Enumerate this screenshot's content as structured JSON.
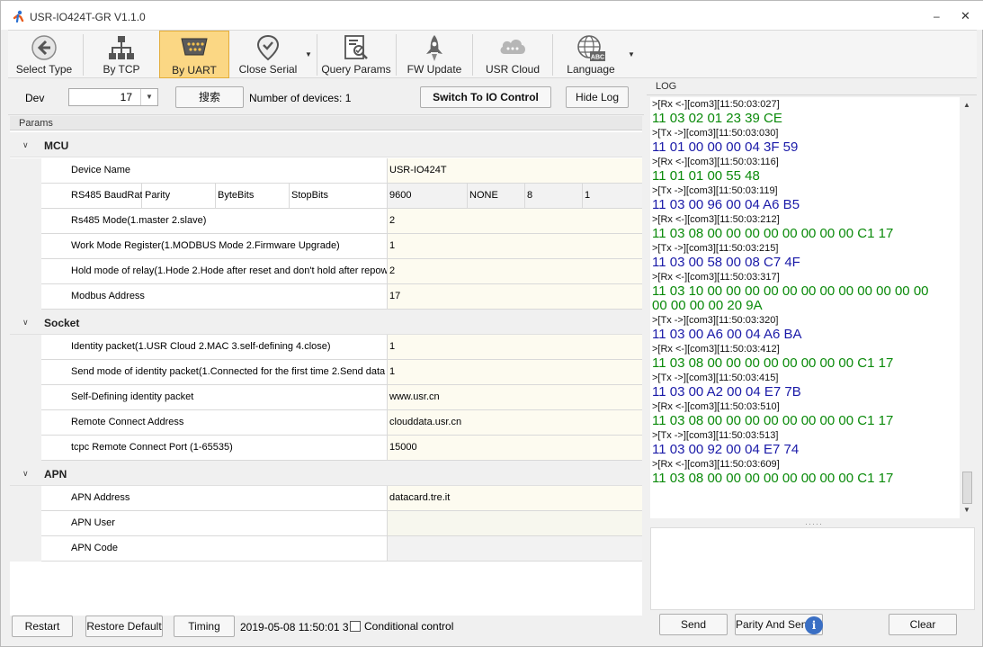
{
  "window": {
    "title": "USR-IO424T-GR V1.1.0"
  },
  "toolbar": {
    "select_type": "Select Type",
    "by_tcp": "By TCP",
    "by_uart": "By UART",
    "close_serial": "Close Serial",
    "query_params": "Query Params",
    "fw_update": "FW Update",
    "usr_cloud": "USR Cloud",
    "language": "Language",
    "language_badge": "ABC"
  },
  "device_bar": {
    "dev_label": "Dev",
    "dev_value": "17",
    "search_button": "搜索",
    "device_count": "Number of devices: 1",
    "switch_button": "Switch To IO Control",
    "hide_log_button": "Hide Log"
  },
  "params": {
    "header": "Params",
    "sections": {
      "mcu": "MCU",
      "socket": "Socket",
      "apn": "APN"
    },
    "mcu_rows": [
      {
        "key": "Device Name",
        "value": "USR-IO424T"
      },
      {
        "key": "Rs485 Mode(1.master 2.slave)",
        "value": "2"
      },
      {
        "key": "Work Mode Register(1.MODBUS Mode 2.Firmware Upgrade)",
        "value": "1"
      },
      {
        "key": "Hold mode of relay(1.Hode 2.Hode after reset and don't hold after repow",
        "value": "2"
      },
      {
        "key": "Modbus Address",
        "value": "17"
      }
    ],
    "rs485_row": {
      "keys": [
        "RS485 BaudRate",
        "Parity",
        "ByteBits",
        "StopBits"
      ],
      "values": [
        "9600",
        "NONE",
        "8",
        "1"
      ]
    },
    "socket_rows": [
      {
        "key": "Identity packet(1.USR Cloud 2.MAC 3.self-defining 4.close)",
        "value": "1"
      },
      {
        "key": "Send mode of identity packet(1.Connected for the first time 2.Send data",
        "value": "1"
      },
      {
        "key": "Self-Defining identity packet",
        "value": "www.usr.cn"
      },
      {
        "key": "Remote Connect Address",
        "value": "clouddata.usr.cn"
      },
      {
        "key": "tcpc Remote Connect Port (1-65535)",
        "value": "15000"
      }
    ],
    "apn_rows": [
      {
        "key": "APN Address",
        "value": "datacard.tre.it"
      },
      {
        "key": "APN User",
        "value": ""
      },
      {
        "key": "APN Code",
        "value": ""
      }
    ]
  },
  "bottom_bar": {
    "restart": "Restart",
    "restore_default": "Restore Default",
    "timing": "Timing",
    "timestamp": "2019-05-08 11:50:01 3",
    "conditional_control": "Conditional control"
  },
  "log": {
    "header": "LOG",
    "entries": [
      {
        "type": "meta",
        "text": ">[Rx <-][com3][11:50:03:027]"
      },
      {
        "type": "rx",
        "text": "11 03 02 01 23 39 CE"
      },
      {
        "type": "meta",
        "text": ">[Tx ->][com3][11:50:03:030]"
      },
      {
        "type": "tx",
        "text": "11 01 00 00 00 04 3F 59"
      },
      {
        "type": "meta",
        "text": ">[Rx <-][com3][11:50:03:116]"
      },
      {
        "type": "rx",
        "text": "11 01 01 00 55 48"
      },
      {
        "type": "meta",
        "text": ">[Tx ->][com3][11:50:03:119]"
      },
      {
        "type": "tx",
        "text": "11 03 00 96 00 04 A6 B5"
      },
      {
        "type": "meta",
        "text": ">[Rx <-][com3][11:50:03:212]"
      },
      {
        "type": "rx",
        "text": "11 03 08 00 00 00 00 00 00 00 00 C1 17"
      },
      {
        "type": "meta",
        "text": ">[Tx ->][com3][11:50:03:215]"
      },
      {
        "type": "tx",
        "text": "11 03 00 58 00 08 C7 4F"
      },
      {
        "type": "meta",
        "text": ">[Rx <-][com3][11:50:03:317]"
      },
      {
        "type": "rx",
        "text": "11 03 10 00 00 00 00 00 00 00 00 00 00 00 00"
      },
      {
        "type": "rx",
        "text": "00 00 00 00 20 9A"
      },
      {
        "type": "meta",
        "text": ">[Tx ->][com3][11:50:03:320]"
      },
      {
        "type": "tx",
        "text": "11 03 00 A6 00 04 A6 BA"
      },
      {
        "type": "meta",
        "text": ">[Rx <-][com3][11:50:03:412]"
      },
      {
        "type": "rx",
        "text": "11 03 08 00 00 00 00 00 00 00 00 C1 17"
      },
      {
        "type": "meta",
        "text": ">[Tx ->][com3][11:50:03:415]"
      },
      {
        "type": "tx",
        "text": "11 03 00 A2 00 04 E7 7B"
      },
      {
        "type": "meta",
        "text": ">[Rx <-][com3][11:50:03:510]"
      },
      {
        "type": "rx",
        "text": "11 03 08 00 00 00 00 00 00 00 00 C1 17"
      },
      {
        "type": "meta",
        "text": ">[Tx ->][com3][11:50:03:513]"
      },
      {
        "type": "tx",
        "text": "11 03 00 92 00 04 E7 74"
      },
      {
        "type": "meta",
        "text": ">[Rx <-][com3][11:50:03:609]"
      },
      {
        "type": "rx",
        "text": "11 03 08 00 00 00 00 00 00 00 00 C1 17"
      }
    ],
    "send": "Send",
    "parity_and_send": "Parity And Send",
    "clear": "Clear",
    "info_icon_text": "i"
  },
  "colors": {
    "rx": "#0a8a0a",
    "tx": "#1a1aa8",
    "active_tab": "#fbd784"
  }
}
